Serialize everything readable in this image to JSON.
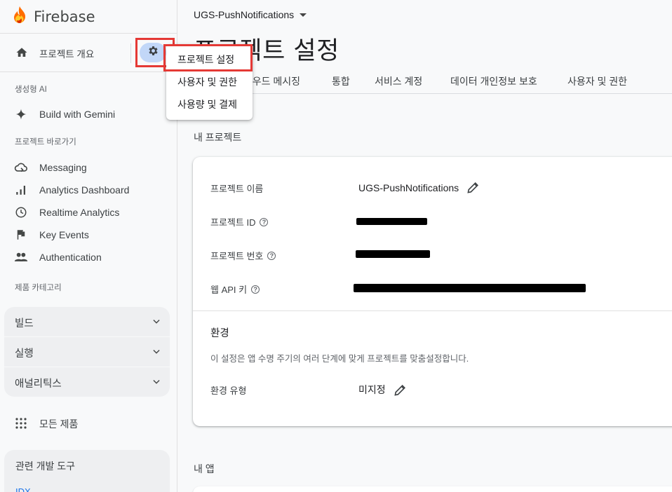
{
  "brand": {
    "name": "Firebase"
  },
  "sidebar": {
    "overview_label": "프로젝트 개요",
    "genai_section": "생성형 AI",
    "gemini_label": "Build with Gemini",
    "shortcuts_section": "프로젝트 바로가기",
    "shortcuts": [
      {
        "label": "Messaging",
        "icon": "cloud-sync-icon"
      },
      {
        "label": "Analytics Dashboard",
        "icon": "bar-chart-icon"
      },
      {
        "label": "Realtime Analytics",
        "icon": "clock-icon"
      },
      {
        "label": "Key Events",
        "icon": "flag-icon"
      },
      {
        "label": "Authentication",
        "icon": "people-icon"
      }
    ],
    "categories_section": "제품 카테고리",
    "categories": [
      "빌드",
      "실행",
      "애널리틱스"
    ],
    "all_products": "모든 제품",
    "tools_title": "관련 개발 도구",
    "idx_link": "IDX"
  },
  "header": {
    "project_name": "UGS-PushNotifications",
    "page_title": "프로젝트 설정"
  },
  "tabs": [
    "클라우드 메시징",
    "통합",
    "서비스 계정",
    "데이터 개인정보 보호",
    "사용자 및 권한"
  ],
  "menu": {
    "items": [
      "프로젝트 설정",
      "사용자 및 권한",
      "사용량 및 결제"
    ]
  },
  "my_project": {
    "heading": "내 프로젝트",
    "rows": {
      "name_label": "프로젝트 이름",
      "name_value": "UGS-PushNotifications",
      "id_label": "프로젝트 ID",
      "number_label": "프로젝트 번호",
      "api_key_label": "웹 API 키"
    },
    "env": {
      "title": "환경",
      "description": "이 설정은 앱 수명 주기의 여러 단계에 맞게 프로젝트를 맞춤설정합니다.",
      "type_label": "환경 유형",
      "type_value": "미지정"
    }
  },
  "my_apps": {
    "heading": "내 앱"
  },
  "colors": {
    "accent": "#1a73e8",
    "highlight_box": "#e53935",
    "gear_bg": "#c2d7f8"
  }
}
